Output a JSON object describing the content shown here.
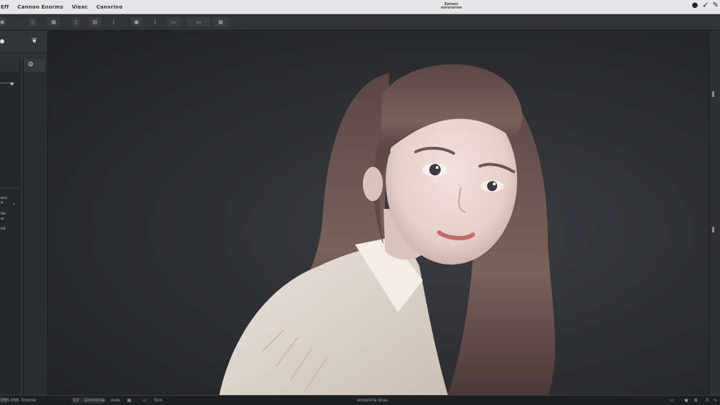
{
  "app": {
    "menus": [
      "Eff",
      "Cannon Enorms",
      "Vieac",
      "Canvrino"
    ],
    "window_title": "Eanaor eniororion"
  },
  "menubar_icons": [
    "circle-icon",
    "bird-icon",
    "feather-icon"
  ],
  "toolbar": {
    "buttons": [
      {
        "icon": "camera-icon",
        "label": "◉"
      },
      {
        "icon": "dot-icon",
        "label": "·"
      },
      {
        "icon": "cylinder-icon",
        "label": "▯"
      },
      {
        "icon": "grid-icon",
        "label": "▦"
      },
      {
        "icon": "bar-icon",
        "label": "▯"
      },
      {
        "icon": "frame-icon",
        "label": "▤"
      },
      {
        "icon": "line-icon",
        "label": "|"
      },
      {
        "icon": "tag-icon",
        "label": "▣"
      },
      {
        "icon": "divider-icon",
        "label": "|"
      },
      {
        "icon": "film-icon",
        "label": "▭"
      },
      {
        "icon": "panel-icon",
        "label": "▭"
      },
      {
        "icon": "layout-icon",
        "label": "▦"
      }
    ]
  },
  "left_panel": {
    "tiny_labels": [
      "ens",
      "0",
      "ite",
      "ai",
      "nd"
    ]
  },
  "statusbar": {
    "items": [
      "ENS",
      "ENS",
      "Enonio",
      "O3",
      "Onnnoiue",
      "ouie",
      "Enn"
    ],
    "center_text": "ennonrre oruu",
    "right_icons": [
      "chart-icon",
      "window-icon",
      "a-icon",
      "wave-icon"
    ]
  },
  "colors": {
    "menubar_bg": "#e7e7e9",
    "toolbar_bg": "#323336",
    "canvas_bg": "#2c2d31",
    "statusbar_bg": "#1e1f21"
  }
}
